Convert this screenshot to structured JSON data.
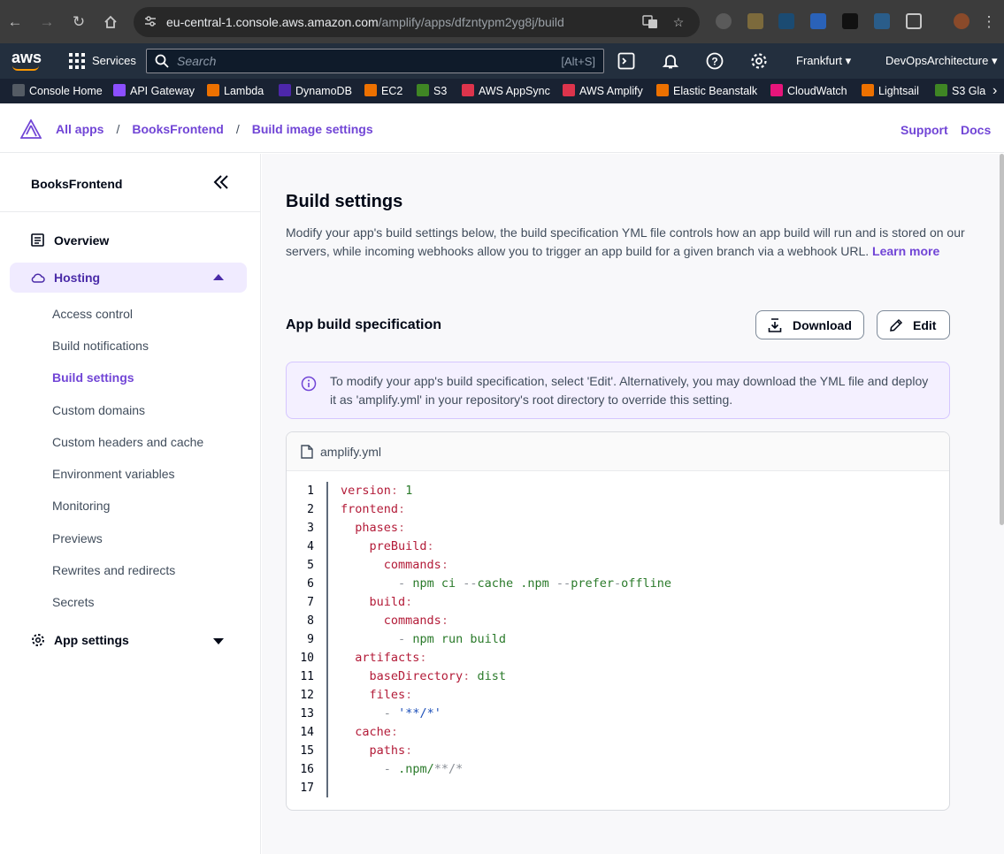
{
  "browser": {
    "url_host": "eu-central-1.console.aws.amazon.com",
    "url_path": "/amplify/apps/dfzntypm2yg8j/build"
  },
  "aws_nav": {
    "logo": "aws",
    "services_label": "Services",
    "search_placeholder": "Search",
    "search_shortcut": "[Alt+S]",
    "region": "Frankfurt",
    "account": "DevOpsArchitecture"
  },
  "favorites": [
    {
      "label": "Console Home",
      "color": "#545b64"
    },
    {
      "label": "API Gateway",
      "color": "#8c4fff"
    },
    {
      "label": "Lambda",
      "color": "#ed7100"
    },
    {
      "label": "DynamoDB",
      "color": "#4d27aa"
    },
    {
      "label": "EC2",
      "color": "#ed7100"
    },
    {
      "label": "S3",
      "color": "#3f8624"
    },
    {
      "label": "AWS AppSync",
      "color": "#dd344c"
    },
    {
      "label": "AWS Amplify",
      "color": "#dd344c"
    },
    {
      "label": "Elastic Beanstalk",
      "color": "#ed7100"
    },
    {
      "label": "CloudWatch",
      "color": "#e7157b"
    },
    {
      "label": "Lightsail",
      "color": "#ed7100"
    },
    {
      "label": "S3 Gla",
      "color": "#3f8624"
    }
  ],
  "breadcrumb": {
    "all_apps": "All apps",
    "app": "BooksFrontend",
    "current": "Build image settings"
  },
  "header_links": {
    "support": "Support",
    "docs": "Docs"
  },
  "sidebar": {
    "app_name": "BooksFrontend",
    "overview": "Overview",
    "hosting": "Hosting",
    "hosting_items": [
      "Access control",
      "Build notifications",
      "Build settings",
      "Custom domains",
      "Custom headers and cache",
      "Environment variables",
      "Monitoring",
      "Previews",
      "Rewrites and redirects",
      "Secrets"
    ],
    "app_settings": "App settings"
  },
  "main": {
    "title": "Build settings",
    "description": "Modify your app's build settings below, the build specification YML file controls how an app build will run and is stored on our servers, while incoming webhooks allow you to trigger an app build for a given branch via a webhook URL.",
    "learn_more": "Learn more",
    "spec_title": "App build specification",
    "download_label": "Download",
    "edit_label": "Edit",
    "info_text": "To modify your app's build specification, select 'Edit'. Alternatively, you may download the YML file and deploy it as 'amplify.yml' in your repository's root directory to override this setting.",
    "file_name": "amplify.yml",
    "line_numbers": [
      "1",
      "2",
      "3",
      "4",
      "5",
      "6",
      "7",
      "8",
      "9",
      "10",
      "11",
      "12",
      "13",
      "14",
      "15",
      "16",
      "17"
    ]
  }
}
